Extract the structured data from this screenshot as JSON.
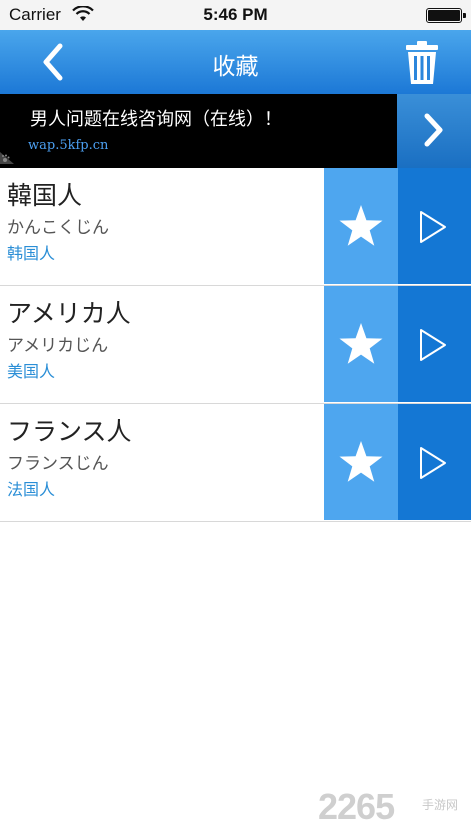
{
  "status_bar": {
    "carrier": "Carrier",
    "time": "5:46 PM",
    "icons": [
      "wifi-icon",
      "battery-icon"
    ]
  },
  "nav": {
    "title": "收藏",
    "back_icon": "chevron-left-icon",
    "trash_icon": "trash-icon"
  },
  "ad": {
    "title": "男人问题在线咨询网（在线）！",
    "url": "wap.5kfp.cn",
    "arrow_icon": "chevron-right-icon"
  },
  "favorites": [
    {
      "word": "韓国人",
      "kana": "かんこくじん",
      "meaning": "韩国人"
    },
    {
      "word": "アメリカ人",
      "kana": "アメリカじん",
      "meaning": "美国人"
    },
    {
      "word": "フランス人",
      "kana": "フランスじん",
      "meaning": "法国人"
    }
  ],
  "watermark": {
    "digits": "2265",
    "tag": "手游网"
  },
  "colors": {
    "nav_top": "#4aa6ec",
    "nav_bottom": "#1c78d6",
    "fav_button": "#4ea6ef",
    "play_button": "#1477d4",
    "meaning_text": "#2a8ed6"
  }
}
